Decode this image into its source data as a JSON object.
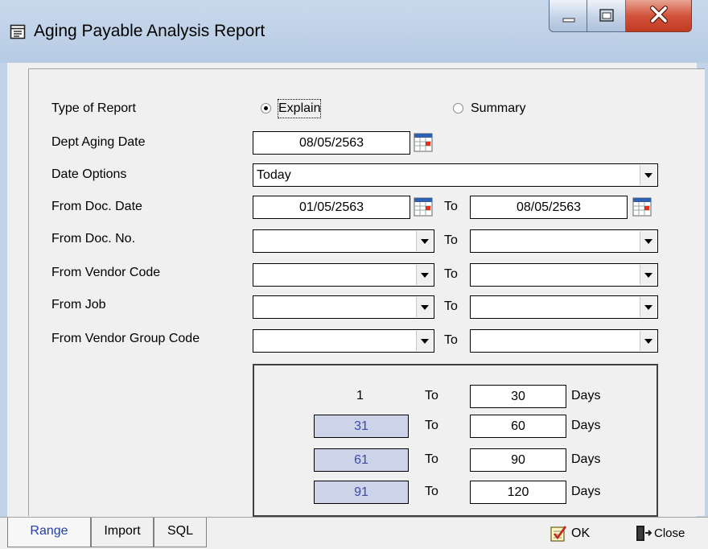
{
  "window": {
    "title": "Aging Payable Analysis Report",
    "icon": "report-icon",
    "controls": [
      "minimize-icon",
      "maximize-icon",
      "close-icon"
    ]
  },
  "form": {
    "type_of_report": {
      "label": "Type of Report",
      "options": [
        {
          "label": "Explain",
          "selected": true
        },
        {
          "label": "Summary",
          "selected": false
        }
      ]
    },
    "dept_aging_date": {
      "label": "Dept Aging Date",
      "value": "08/05/2563"
    },
    "date_options": {
      "label": "Date Options",
      "value": "Today"
    },
    "from_doc_date": {
      "label": "From Doc. Date",
      "from": "01/05/2563",
      "to_label": "To",
      "to": "08/05/2563"
    },
    "from_doc_no": {
      "label": "From Doc. No.",
      "from": "",
      "to_label": "To",
      "to": ""
    },
    "from_vendor_code": {
      "label": "From Vendor Code",
      "from": "",
      "to_label": "To",
      "to": ""
    },
    "from_job": {
      "label": "From Job",
      "from": "",
      "to_label": "To",
      "to": ""
    },
    "from_vendor_group_code": {
      "label": "From Vendor Group Code",
      "from": "",
      "to_label": "To",
      "to": ""
    }
  },
  "aging_ranges": [
    {
      "from": "1",
      "to_label": "To",
      "to": "30",
      "unit": "Days"
    },
    {
      "from": "31",
      "to_label": "To",
      "to": "60",
      "unit": "Days"
    },
    {
      "from": "61",
      "to_label": "To",
      "to": "90",
      "unit": "Days"
    },
    {
      "from": "91",
      "to_label": "To",
      "to": "120",
      "unit": "Days"
    }
  ],
  "tabs": [
    {
      "label": "Range",
      "active": true
    },
    {
      "label": "Import",
      "active": false
    },
    {
      "label": "SQL",
      "active": false
    }
  ],
  "buttons": {
    "ok": "OK",
    "close": "Close"
  },
  "colors": {
    "active_tab": "#1f3fb0",
    "shaded_field_bg": "#cdd4ea",
    "shaded_field_text": "#3b4aa6",
    "close_button": "#c23a22"
  }
}
